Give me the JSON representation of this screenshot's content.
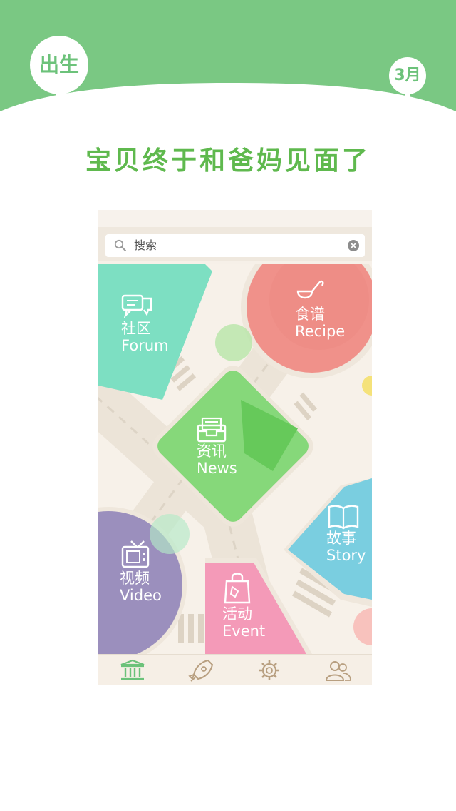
{
  "header": {
    "start_label": "出生",
    "end_label": "3月",
    "tagline": "宝贝终于和爸妈见面了"
  },
  "search": {
    "placeholder": "搜索"
  },
  "tiles": {
    "forum": {
      "cn": "社区",
      "en": "Forum",
      "icon": "chat-bubbles-icon"
    },
    "recipe": {
      "cn": "食谱",
      "en": "Recipe",
      "icon": "ladle-icon"
    },
    "news": {
      "cn": "资讯",
      "en": "News",
      "icon": "inbox-tray-icon"
    },
    "story": {
      "cn": "故事",
      "en": "Story",
      "icon": "open-book-icon"
    },
    "video": {
      "cn": "视频",
      "en": "Video",
      "icon": "tv-icon"
    },
    "event": {
      "cn": "活动",
      "en": "Event",
      "icon": "shopping-bag-icon"
    }
  },
  "tabbar": {
    "items": [
      {
        "icon": "building-icon",
        "active": true
      },
      {
        "icon": "rocket-icon",
        "active": false
      },
      {
        "icon": "gear-icon",
        "active": false
      },
      {
        "icon": "users-icon",
        "active": false
      }
    ]
  },
  "colors": {
    "header_green": "#7ac883",
    "tagline_green": "#5fb94e",
    "forum": "#7ddfc2",
    "recipe": "#f0918a",
    "news": "#86d87a",
    "story": "#7acee0",
    "video": "#9b8fbd",
    "event": "#f49ab8"
  }
}
